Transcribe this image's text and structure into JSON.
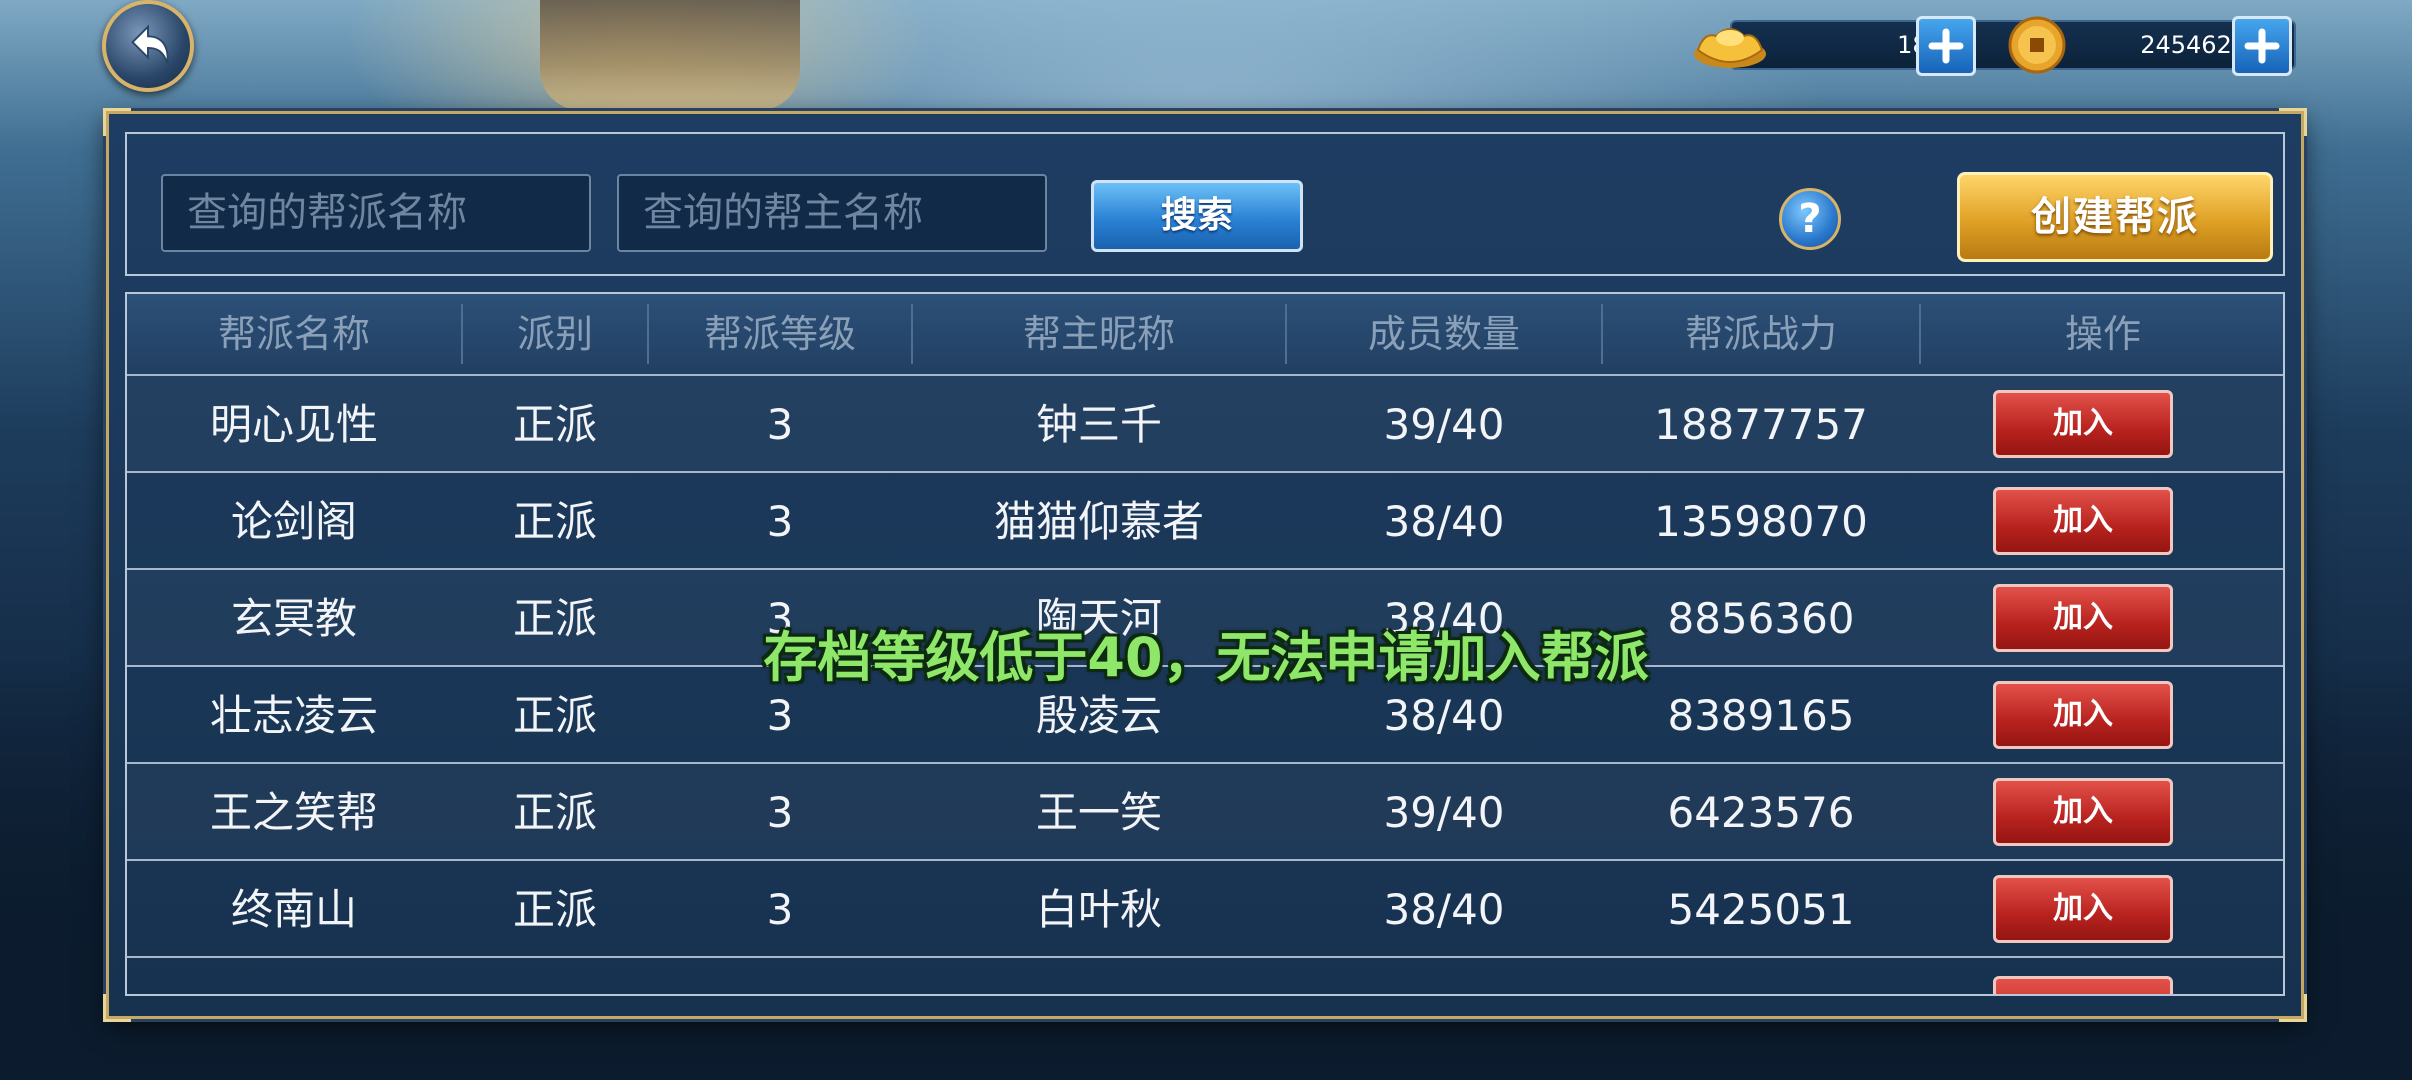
{
  "currencies": [
    {
      "name": "gold-ingot-icon",
      "value": "180"
    },
    {
      "name": "copper-coin-icon",
      "value": "245462"
    }
  ],
  "search": {
    "guild_name_placeholder": "查询的帮派名称",
    "leader_name_placeholder": "查询的帮主名称",
    "search_label": "搜索",
    "help_label": "?",
    "create_label": "创建帮派"
  },
  "table": {
    "headers": [
      "帮派名称",
      "派别",
      "帮派等级",
      "帮主昵称",
      "成员数量",
      "帮派战力",
      "操作"
    ],
    "rows": [
      {
        "name": "明心见性",
        "faction": "正派",
        "level": "3",
        "leader": "钟三千",
        "members": "39/40",
        "power": "18877757",
        "action": "加入"
      },
      {
        "name": "论剑阁",
        "faction": "正派",
        "level": "3",
        "leader": "猫猫仰慕者",
        "members": "38/40",
        "power": "13598070",
        "action": "加入"
      },
      {
        "name": "玄冥教",
        "faction": "正派",
        "level": "3",
        "leader": "陶天河",
        "members": "38/40",
        "power": "8856360",
        "action": "加入"
      },
      {
        "name": "壮志凌云",
        "faction": "正派",
        "level": "3",
        "leader": "殷凌云",
        "members": "38/40",
        "power": "8389165",
        "action": "加入"
      },
      {
        "name": "王之笑帮",
        "faction": "正派",
        "level": "3",
        "leader": "王一笑",
        "members": "39/40",
        "power": "6423576",
        "action": "加入"
      },
      {
        "name": "终南山",
        "faction": "正派",
        "level": "3",
        "leader": "白叶秋",
        "members": "38/40",
        "power": "5425051",
        "action": "加入"
      }
    ]
  },
  "toast": "存档等级低于40，无法申请加入帮派",
  "colors": {
    "accent_gold": "#e0a126",
    "join_red": "#b8221e",
    "search_blue": "#2a82d4",
    "toast_green": "#8fe76a"
  }
}
